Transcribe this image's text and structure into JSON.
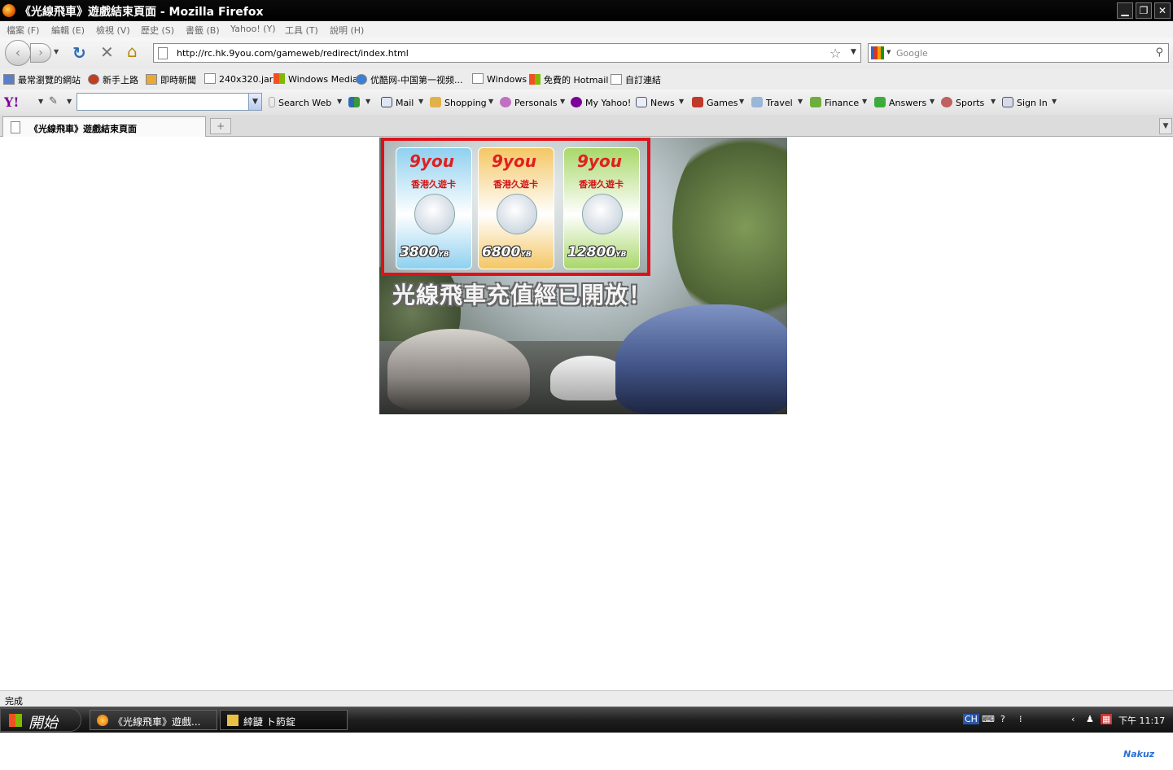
{
  "window": {
    "title": "《光線飛車》遊戲結束頁面 - Mozilla Firefox"
  },
  "menu": {
    "items": [
      "檔案 (F)",
      "編輯 (E)",
      "檢視 (V)",
      "歷史 (S)",
      "書籤 (B)",
      "Yahoo! (Y)",
      "工具 (T)",
      "說明 (H)"
    ]
  },
  "nav": {
    "url": "http://rc.hk.9you.com/gameweb/redirect/index.html",
    "search_placeholder": "Google"
  },
  "bookmarks": [
    "最常瀏覽的網站",
    "新手上路",
    "即時新聞",
    "240x320.jar",
    "Windows Media",
    "优酷网-中国第一视频...",
    "Windows",
    "免費的 Hotmail",
    "自訂連結"
  ],
  "yahoo": {
    "logo": "Y!",
    "items": [
      "Search Web",
      "Mail",
      "Shopping",
      "Personals",
      "My Yahoo!",
      "News",
      "Games",
      "Travel",
      "Finance",
      "Answers",
      "Sports",
      "Sign In"
    ]
  },
  "tab": {
    "title": "《光線飛車》遊戲結束頁面"
  },
  "content": {
    "headline": "光線飛車充值經已開放！",
    "cards": [
      {
        "brand": "9you",
        "name": "香港久遊卡",
        "value": "3800",
        "unit": "YB",
        "color": "#8fd0ef"
      },
      {
        "brand": "9you",
        "name": "香港久遊卡",
        "value": "6800",
        "unit": "YB",
        "color": "#f4c765"
      },
      {
        "brand": "9you",
        "name": "香港久遊卡",
        "value": "12800",
        "unit": "YB",
        "color": "#a8d86a"
      }
    ]
  },
  "status": {
    "text": "完成"
  },
  "taskbar": {
    "start_label": "開始",
    "tasks": [
      "《光線飛車》遊戲...",
      "緈疀 ト箹錠"
    ],
    "tray_lang": "CH",
    "clock": "下午 11:17"
  },
  "watermark": "Nakuz"
}
